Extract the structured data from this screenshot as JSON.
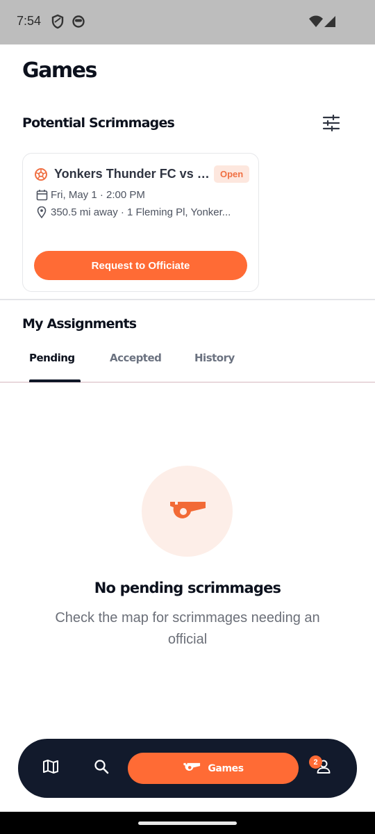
{
  "status_bar": {
    "time": "7:54",
    "icons": [
      "shield-icon",
      "face-icon",
      "wifi-icon",
      "signal-icon"
    ]
  },
  "page": {
    "title": "Games"
  },
  "potential": {
    "title": "Potential Scrimmages",
    "filter_icon": "sliders-icon",
    "card": {
      "icon": "soccer-ball-icon",
      "title": "Yonkers Thunder FC vs T...",
      "badge": "Open",
      "date": "Fri, May 1 · 2:00 PM",
      "location": "350.5 mi away · 1 Fleming Pl, Yonker...",
      "cta": "Request to Officiate"
    }
  },
  "assignments": {
    "title": "My Assignments",
    "tabs": [
      {
        "label": "Pending",
        "active": true
      },
      {
        "label": "Accepted",
        "active": false
      },
      {
        "label": "History",
        "active": false
      }
    ]
  },
  "empty_state": {
    "icon": "whistle-icon",
    "title": "No pending scrimmages",
    "subtitle": "Check the map for scrimmages needing an official"
  },
  "bottom_nav": {
    "items": [
      {
        "icon": "map-icon"
      },
      {
        "icon": "search-icon"
      },
      {
        "icon": "whistle-icon",
        "label": "Games",
        "active": true
      },
      {
        "icon": "profile-icon",
        "badge": "2"
      }
    ]
  },
  "colors": {
    "accent": "#ff6b35",
    "nav_bg": "#121a2c",
    "badge_bg": "#fde7de"
  }
}
